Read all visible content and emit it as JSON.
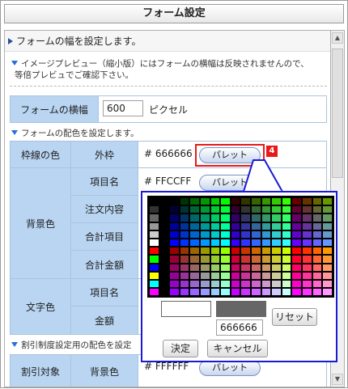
{
  "window": {
    "title": "フォーム設定"
  },
  "sections": {
    "width_head": "フォームの幅を設定します。",
    "width_note_1": "イメージプレビュー（縮小版）にはフォームの横幅は反映されませんので、",
    "width_note_2": "等倍プレビュでご確認下さい。",
    "form_width_label": "フォームの横幅",
    "form_width_value": "600",
    "form_width_unit": "ピクセル",
    "color_head": "フォームの配色を設定します。",
    "discount_head": "割引制度設定用の配色を設定"
  },
  "table": {
    "border_color": "枠線の色",
    "outer_frame": "外枠",
    "outer_frame_value": "# 666666",
    "background": "背景色",
    "item_name": "項目名",
    "item_name_value": "# FFCCFF",
    "order_content": "注文内容",
    "subtotal": "合計項目",
    "total_amount": "合計金額",
    "text_color": "文字色",
    "text_item_name": "項目名",
    "amount": "金額",
    "discount_target": "割引対象",
    "discount_bg": "背景色",
    "discount_bg_value": "# FFFFFF",
    "palette_label": "パレット"
  },
  "annotation": {
    "step_number": "4",
    "highlight_color": "#e81b1b"
  },
  "picker": {
    "hex_value": "666666",
    "reset_label": "リセット",
    "ok_label": "決定",
    "cancel_label": "キャンセル",
    "current_color": "#ffffff",
    "new_color": "#666666"
  },
  "colors": {
    "label_bg": "#b9d5f2",
    "popup_border": "#1a1ad6"
  }
}
